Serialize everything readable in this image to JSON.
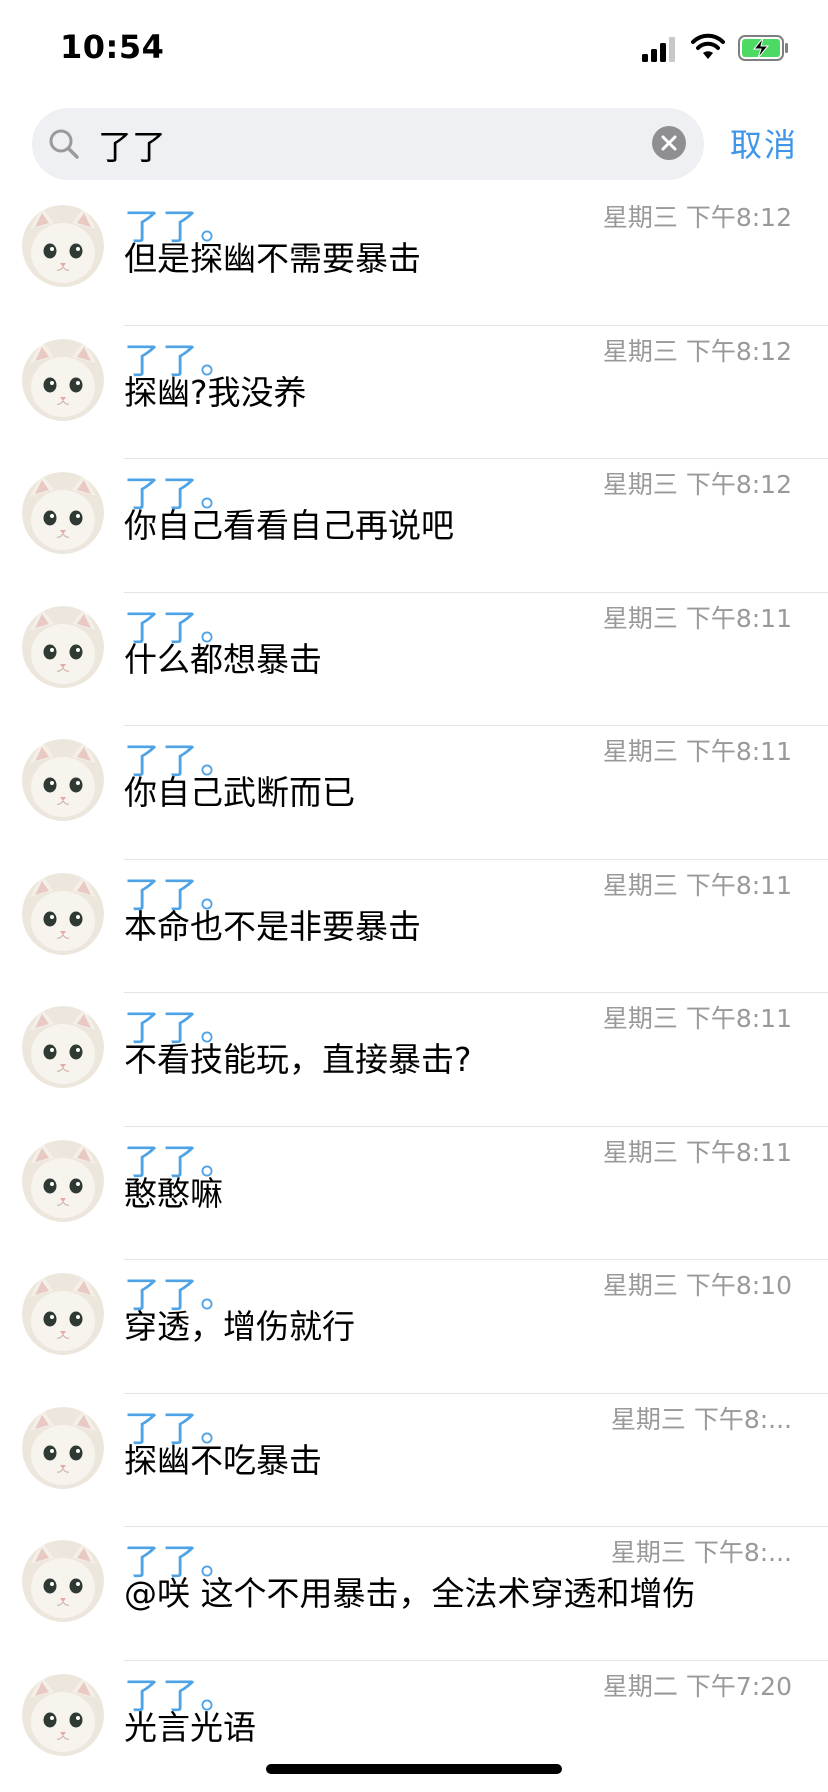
{
  "status": {
    "time": "10:54"
  },
  "search": {
    "query": "了了",
    "cancel_label": "取消"
  },
  "accent_color": "#4ea2e6",
  "results": [
    {
      "name": "了了。",
      "time": "星期三 下午8:12",
      "message": "但是探幽不需要暴击"
    },
    {
      "name": "了了。",
      "time": "星期三 下午8:12",
      "message": "探幽?我没养"
    },
    {
      "name": "了了。",
      "time": "星期三 下午8:12",
      "message": "你自己看看自己再说吧"
    },
    {
      "name": "了了。",
      "time": "星期三 下午8:11",
      "message": "什么都想暴击"
    },
    {
      "name": "了了。",
      "time": "星期三 下午8:11",
      "message": "你自己武断而已"
    },
    {
      "name": "了了。",
      "time": "星期三 下午8:11",
      "message": "本命也不是非要暴击"
    },
    {
      "name": "了了。",
      "time": "星期三 下午8:11",
      "message": "不看技能玩，直接暴击?"
    },
    {
      "name": "了了。",
      "time": "星期三 下午8:11",
      "message": "憨憨嘛"
    },
    {
      "name": "了了。",
      "time": "星期三 下午8:10",
      "message": "穿透，增伤就行"
    },
    {
      "name": "了了。",
      "time": "星期三 下午8:...",
      "message": "探幽不吃暴击"
    },
    {
      "name": "了了。",
      "time": "星期三 下午8:...",
      "message": "@咲 这个不用暴击，全法术穿透和增伤"
    },
    {
      "name": "了了。",
      "time": "星期二 下午7:20",
      "message": "光言光语"
    }
  ]
}
